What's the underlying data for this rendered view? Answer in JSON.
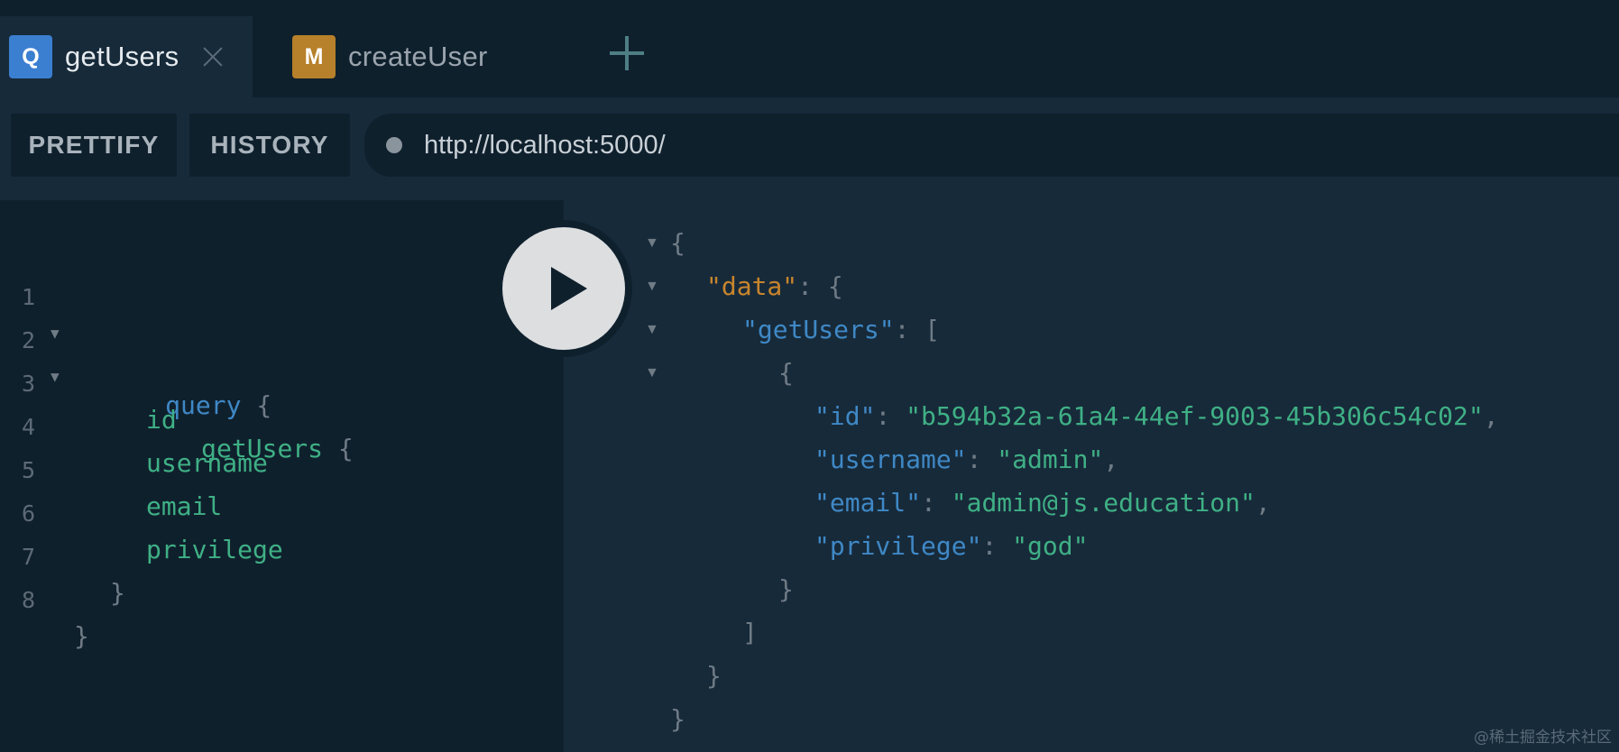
{
  "tabs": [
    {
      "badge": "Q",
      "label": "getUsers",
      "badge_color": "#3b7fd1",
      "active": true
    },
    {
      "badge": "M",
      "label": "createUser",
      "badge_color": "#b7802a",
      "active": false
    }
  ],
  "toolbar": {
    "prettify_label": "PRETTIFY",
    "history_label": "HISTORY",
    "endpoint_url": "http://localhost:5000/"
  },
  "editor": {
    "line_numbers": [
      "1",
      "2",
      "3",
      "4",
      "5",
      "6",
      "7",
      "8"
    ],
    "lines": {
      "l1_keyword": "query",
      "l1_brace": "{",
      "l2_field": "getUsers",
      "l2_brace": "{",
      "l3_field": "id",
      "l4_field": "username",
      "l5_field": "email",
      "l6_field": "privilege",
      "l7_brace": "}",
      "l8_brace": "}"
    }
  },
  "result": {
    "open_brace": "{",
    "data_key": "\"data\"",
    "colon": ":",
    "data_open": "{",
    "getusers_key": "\"getUsers\"",
    "array_open": "[",
    "obj_open": "{",
    "fields": [
      {
        "key": "\"id\"",
        "value": "\"b594b32a-61a4-44ef-9003-45b306c54c02\"",
        "trail": ","
      },
      {
        "key": "\"username\"",
        "value": "\"admin\"",
        "trail": ","
      },
      {
        "key": "\"email\"",
        "value": "\"admin@js.education\"",
        "trail": ","
      },
      {
        "key": "\"privilege\"",
        "value": "\"god\"",
        "trail": ""
      }
    ],
    "obj_close": "}",
    "array_close": "]",
    "data_close": "}",
    "close_brace": "}"
  },
  "fold_marker": "▼",
  "watermark": "@稀土掘金技术社区",
  "colors": {
    "background": "#172a3a",
    "panel": "#0f202d",
    "keyword": "#3f88c5",
    "field": "#3fb085",
    "data_key": "#c8852c"
  },
  "icons": {
    "close_tab": "close-icon",
    "add_tab": "plus-icon",
    "run": "play-icon",
    "status": "status-dot-icon"
  }
}
